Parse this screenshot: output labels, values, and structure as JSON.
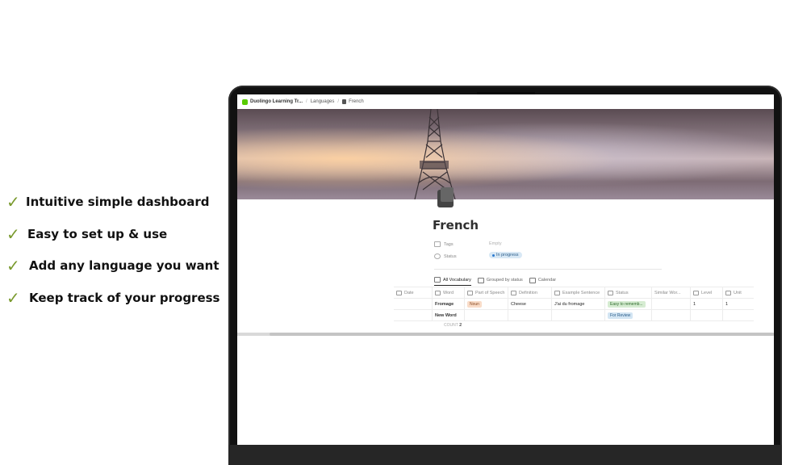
{
  "features": [
    {
      "label": "Intuitive simple dashboard"
    },
    {
      "label": "Easy to set up & use"
    },
    {
      "label": "Add any language you want"
    },
    {
      "label": "Keep track of your progress"
    }
  ],
  "breadcrumb": {
    "workspace": "Duolingo Learning Tr...",
    "parent": "Languages",
    "page": "French"
  },
  "page": {
    "title": "French",
    "properties": [
      {
        "name": "Tags",
        "value": "Empty"
      },
      {
        "name": "Status",
        "value": "In progress"
      }
    ]
  },
  "views": [
    "All Vocabulary",
    "Grouped by status",
    "Calendar"
  ],
  "table": {
    "headers": [
      "Date",
      "Word",
      "Part of Speech",
      "Definition",
      "Example Sentence",
      "Status",
      "Similar Wor...",
      "Level",
      "Unit"
    ],
    "rows": [
      [
        "",
        "Fromage",
        "Noun",
        "Cheese",
        "J'ai du fromage",
        "Easy to rememb...",
        "",
        "1",
        "1"
      ],
      [
        "",
        "New Word",
        "",
        "",
        "",
        "For Review",
        "",
        "",
        ""
      ]
    ],
    "count_label": "COUNT",
    "count_value": "2"
  },
  "colors": {
    "check": "#7a9a2e",
    "noun_tag_bg": "#f9dcc8",
    "easy_tag_bg": "#d6ecd2",
    "review_tag_bg": "#d3e5f3",
    "brand": "#58cc02"
  }
}
